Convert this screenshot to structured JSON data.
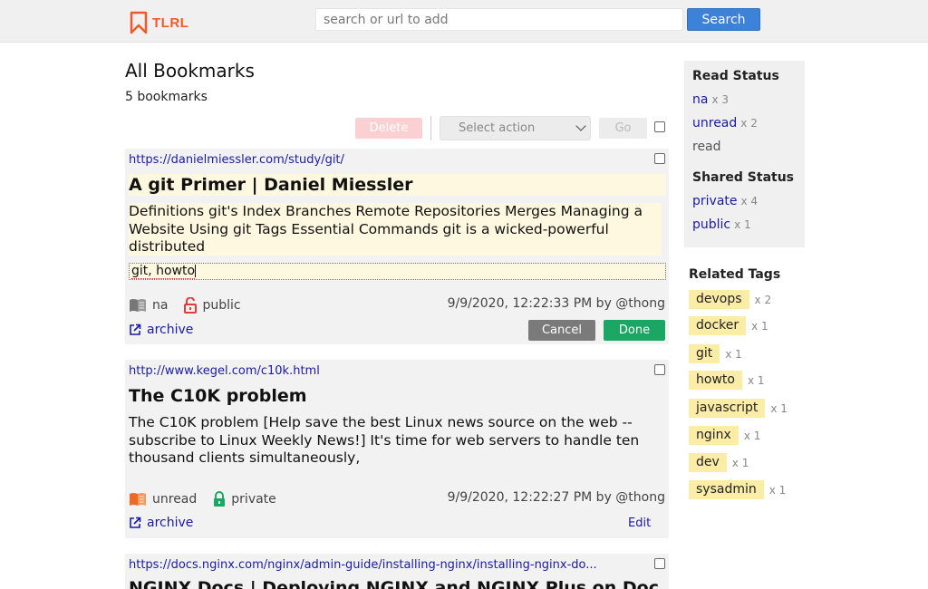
{
  "header": {
    "logo_text": "TLRL",
    "search_placeholder": "search or url to add",
    "search_button": "Search",
    "accent_color": "#f05a28"
  },
  "main": {
    "title": "All Bookmarks",
    "count_text": "5 bookmarks"
  },
  "toolbar": {
    "delete_label": "Delete",
    "select_placeholder": "Select action",
    "go_label": "Go"
  },
  "bookmarks": [
    {
      "url": "https://danielmiessler.com/study/git/",
      "title": "A git Primer | Daniel Miessler",
      "description": "Definitions git's Index Branches Remote Repositories Merges Managing a Website Using git Tags Essential Commands git is a wicked-powerful distributed",
      "tags_value": "git, howto",
      "read_status": "na",
      "shared_status": "public",
      "timestamp": "9/9/2020, 12:22:33 PM by @thong",
      "archive_label": "archive",
      "cancel_label": "Cancel",
      "done_label": "Done",
      "read_icon": "book-icon",
      "shared_icon": "lock-open-icon"
    },
    {
      "url": "http://www.kegel.com/c10k.html",
      "title": "The C10K problem",
      "description": "The C10K problem [Help save the best Linux news source on the web -- subscribe to Linux Weekly News!] It's time for web servers to handle ten thousand clients simultaneously,",
      "read_status": "unread",
      "shared_status": "private",
      "timestamp": "9/9/2020, 12:22:27 PM by @thong",
      "archive_label": "archive",
      "edit_label": "Edit",
      "read_icon": "book-icon",
      "shared_icon": "lock-closed-icon"
    },
    {
      "url": "https://docs.nginx.com/nginx/admin-guide/installing-nginx/installing-nginx-do...",
      "title": "NGINX Docs | Deploying NGINX and NGINX Plus on Doc"
    }
  ],
  "sidebar": {
    "read_status_heading": "Read Status",
    "read_status": [
      {
        "label": "na",
        "count": "x 3"
      },
      {
        "label": "unread",
        "count": "x 2"
      },
      {
        "label": "read",
        "count": ""
      }
    ],
    "shared_status_heading": "Shared Status",
    "shared_status": [
      {
        "label": "private",
        "count": "x 4"
      },
      {
        "label": "public",
        "count": "x 1"
      }
    ],
    "related_tags_heading": "Related Tags",
    "related_tags": [
      {
        "label": "devops",
        "count": "x 2"
      },
      {
        "label": "docker",
        "count": "x 1"
      },
      {
        "label": "git",
        "count": "x 1"
      },
      {
        "label": "howto",
        "count": "x 1"
      },
      {
        "label": "javascript",
        "count": "x 1"
      },
      {
        "label": "nginx",
        "count": "x 1"
      },
      {
        "label": "dev",
        "count": "x 1"
      },
      {
        "label": "sysadmin",
        "count": "x 1"
      }
    ]
  },
  "colors": {
    "link": "#1a1aa6",
    "tag_bg": "#fbeda6",
    "highlight_bg": "#fdf8df",
    "done_green": "#1ca663",
    "cancel_gray": "#7a7a7a",
    "search_blue": "#3b82d8"
  }
}
